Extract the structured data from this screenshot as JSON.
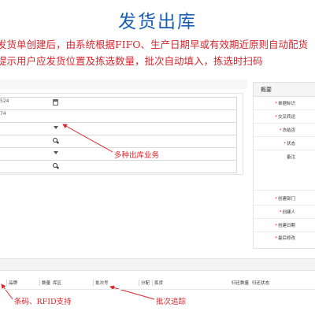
{
  "title": "发货出库",
  "description": {
    "line1": "发货单创建后，由系统根据FIFO、生产日期早或有效期近原则自动配货",
    "line2": "提示用户应发货位置及拣选数量，批次自动填入，拣选时扫码"
  },
  "form": {
    "rows": [
      {
        "value": "524",
        "icon": "calendar-icon"
      },
      {
        "value": "74",
        "icon": ""
      },
      {
        "value": "",
        "icon": "chevron-down-icon"
      },
      {
        "value": "",
        "icon": "search-icon"
      },
      {
        "value": "",
        "icon": "chevron-down-icon"
      },
      {
        "value": "",
        "icon": "search-icon"
      }
    ]
  },
  "annotations": {
    "business": "多种出库业务",
    "barcode": "条码、RFID支持",
    "batch": "批次追踪"
  },
  "panel": {
    "header": "概要",
    "fields": [
      {
        "label": "单据标识",
        "required": true
      },
      {
        "label": "交叉转运",
        "required": true
      },
      {
        "label": "冻结否",
        "required": true
      },
      {
        "label": "状态",
        "required": true
      },
      {
        "label": "备注",
        "required": false
      },
      {
        "label": "创建部门",
        "required": true
      },
      {
        "label": "创建人",
        "required": true
      },
      {
        "label": "创建日期",
        "required": true
      },
      {
        "label": "最后修改",
        "required": true
      }
    ]
  },
  "table": {
    "headers": [
      "品牌",
      "数量",
      "库区",
      "批次号",
      "分配",
      "拣货",
      "归还数量",
      "归还状态"
    ]
  },
  "colors": {
    "title": "#1a5fb4",
    "annotation": "#d9262c",
    "required": "#d9262c"
  }
}
